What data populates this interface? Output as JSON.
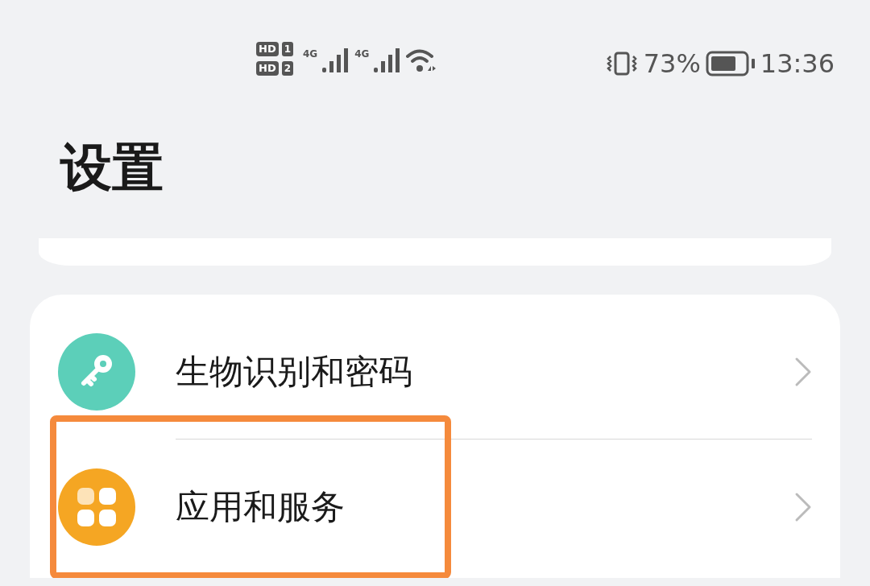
{
  "status_bar": {
    "sim_labels": [
      {
        "badge": "HD",
        "slot": "1"
      },
      {
        "badge": "HD",
        "slot": "2"
      }
    ],
    "networks": [
      "4G",
      "4G"
    ],
    "battery": "73%",
    "time": "13:36"
  },
  "title": "设置",
  "items": [
    {
      "label": "生物识别和密码",
      "kind": "key",
      "color": "#5ccfb9",
      "highlighted": false
    },
    {
      "label": "应用和服务",
      "kind": "apps",
      "color": "#f5a623",
      "highlighted": true
    }
  ]
}
